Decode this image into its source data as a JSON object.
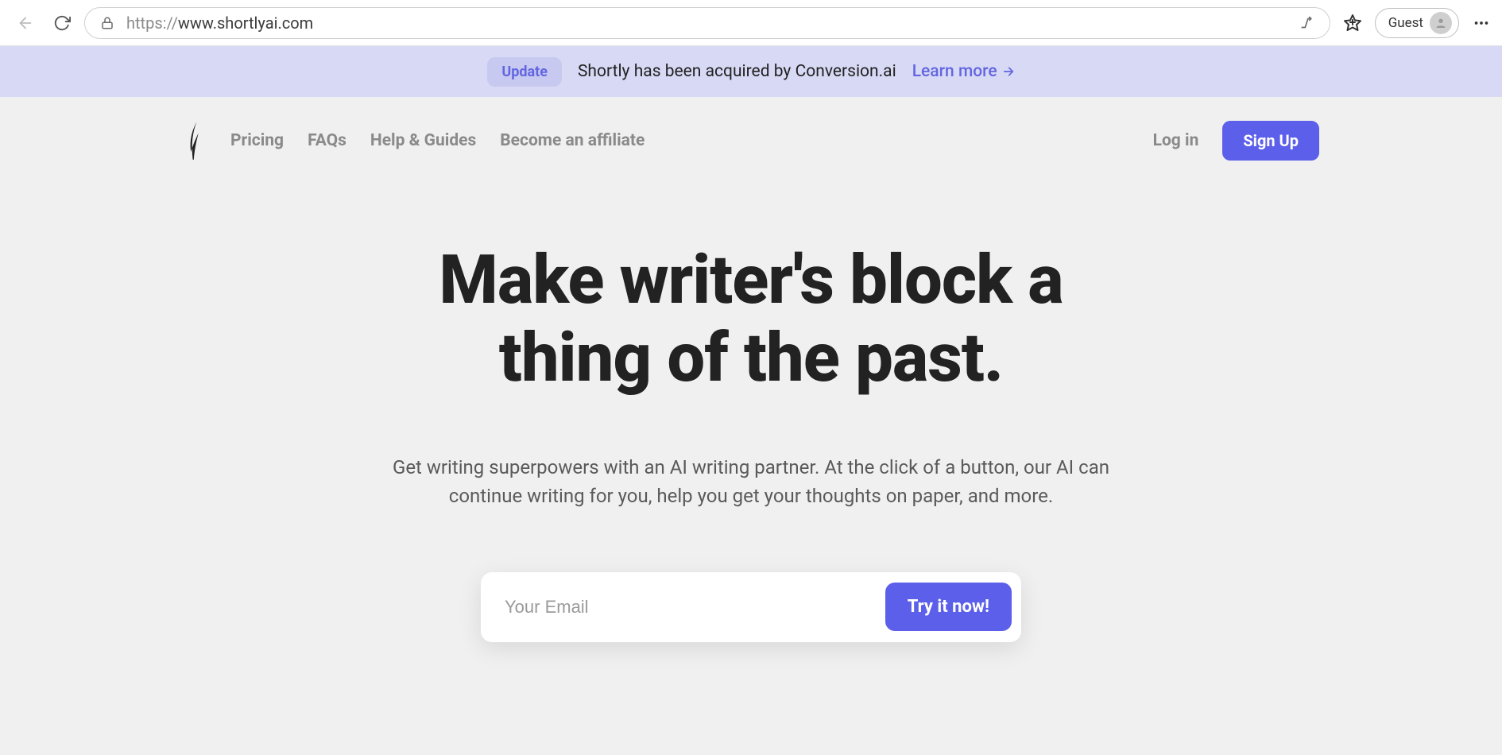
{
  "browser": {
    "url_prefix": "https://",
    "url_rest": "www.shortlyai.com",
    "guest_label": "Guest"
  },
  "announce": {
    "pill": "Update",
    "text": "Shortly has been acquired by Conversion.ai",
    "learn": "Learn more"
  },
  "nav": {
    "items": [
      "Pricing",
      "FAQs",
      "Help & Guides",
      "Become an affiliate"
    ],
    "login": "Log in",
    "signup": "Sign Up"
  },
  "hero": {
    "headline_l1": "Make writer's block a",
    "headline_l2": "thing of the past.",
    "sub": "Get writing superpowers with an AI writing partner. At the click of a button, our AI can continue writing for you, help you get your thoughts on paper, and more.",
    "email_placeholder": "Your Email",
    "cta": "Try it now!"
  }
}
